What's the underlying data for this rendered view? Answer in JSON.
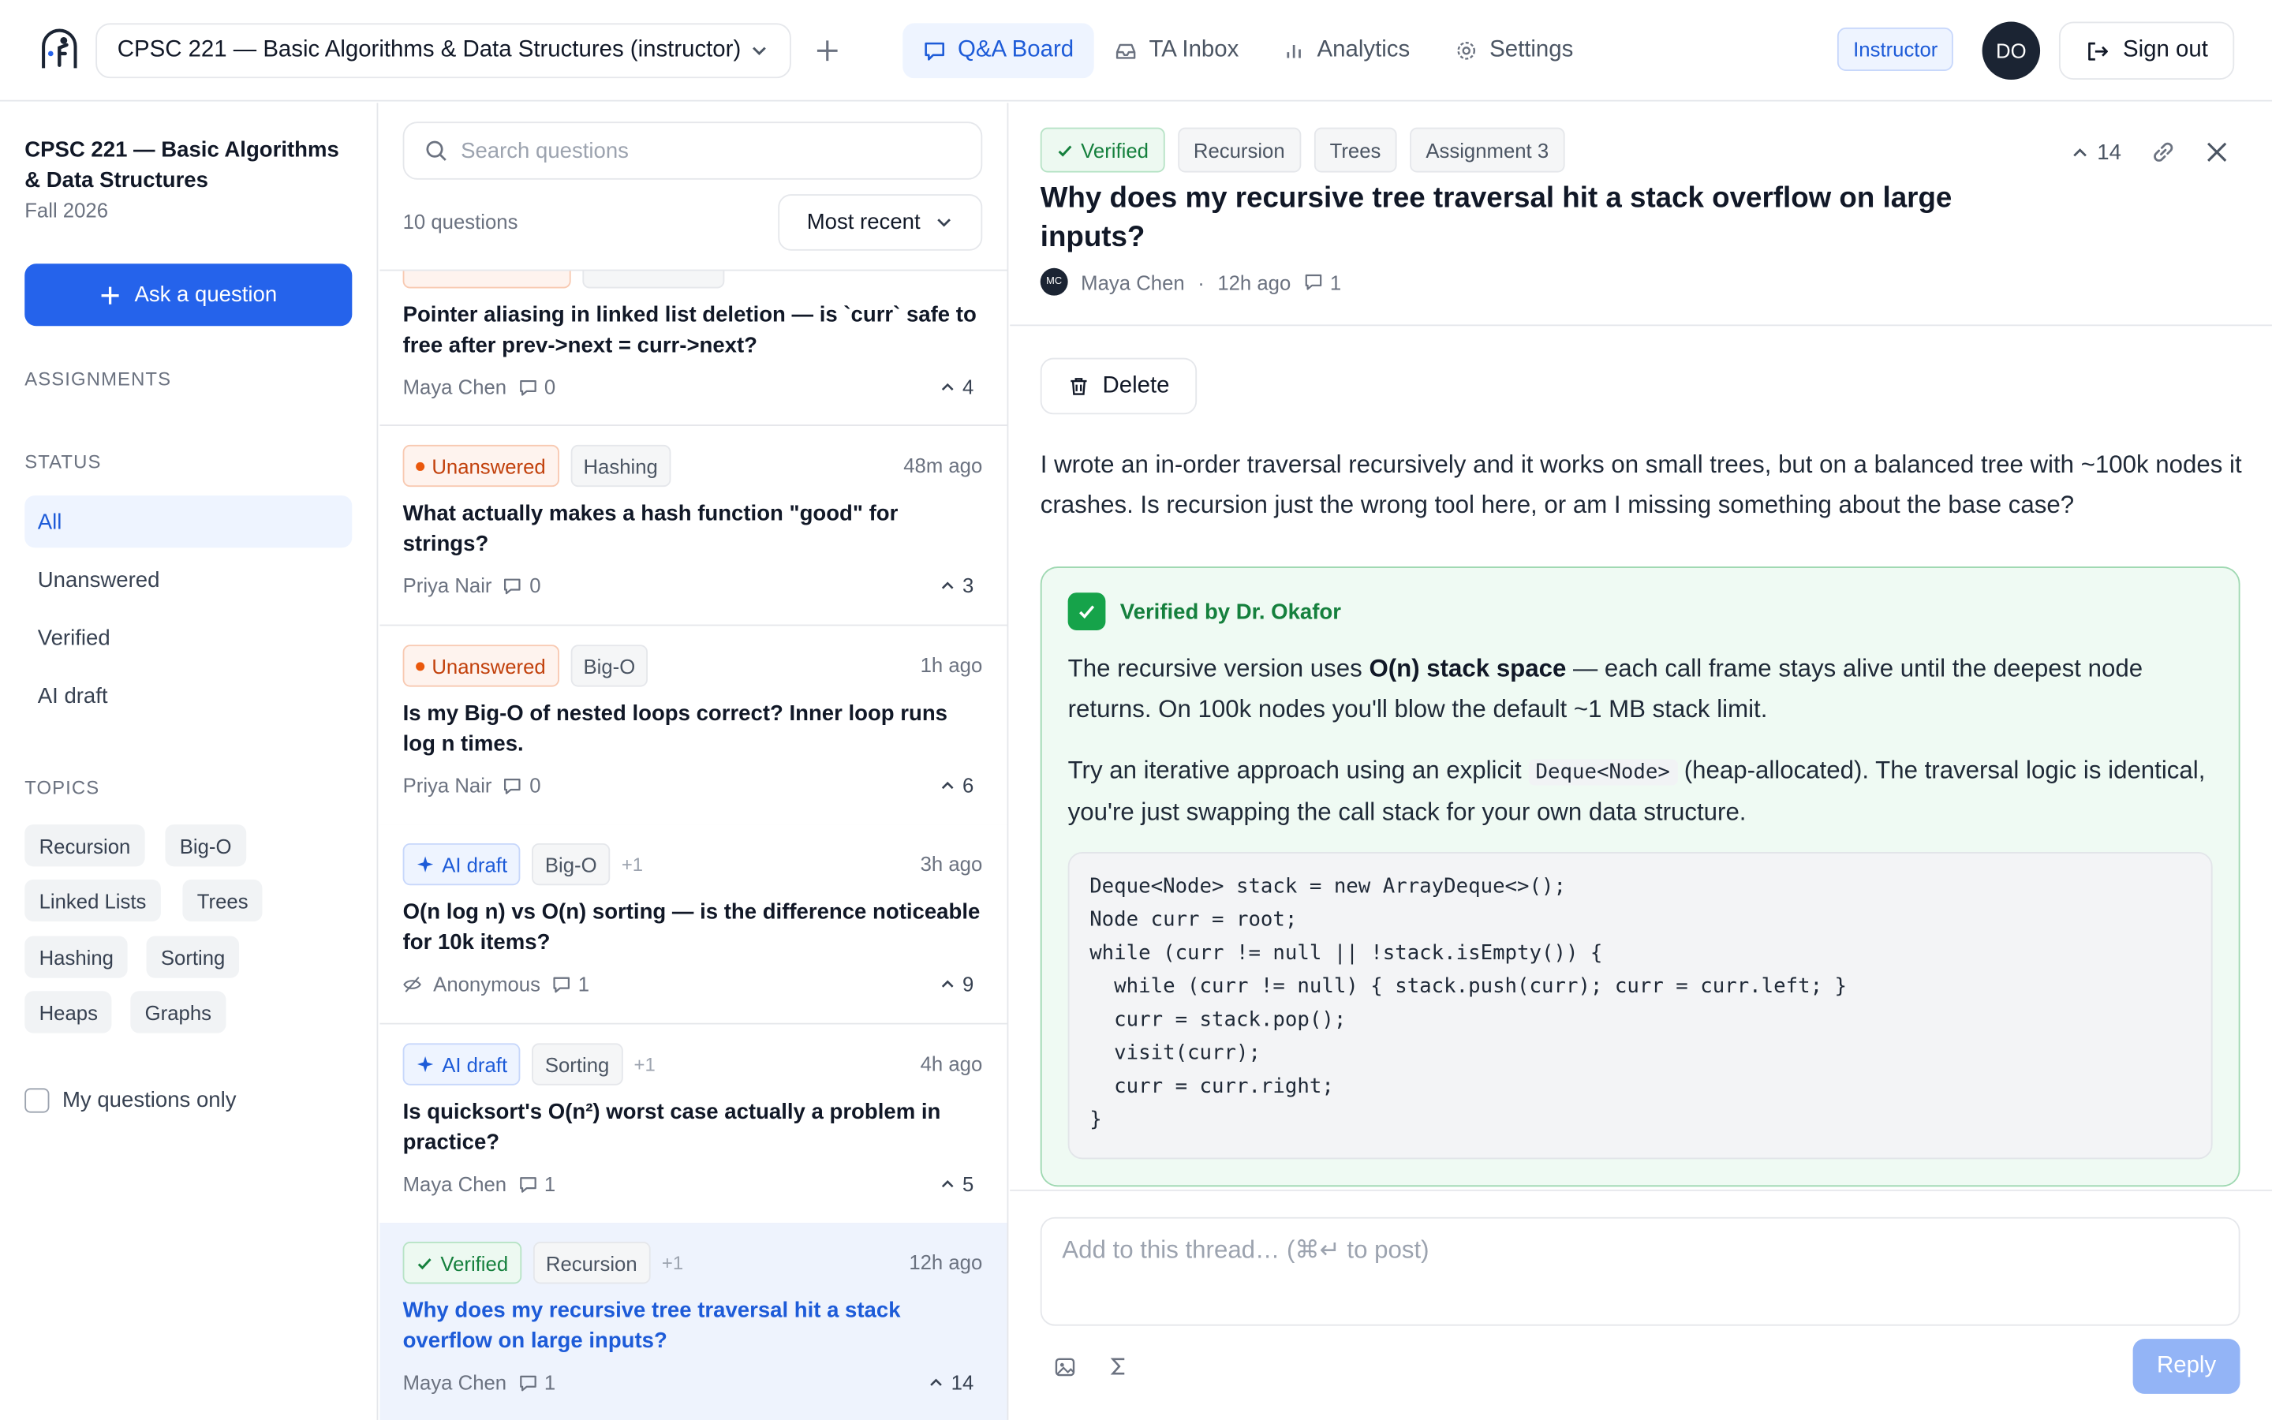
{
  "header": {
    "course_select": "CPSC 221 — Basic Algorithms & Data Structures (instructor)",
    "nav": [
      {
        "label": "Q&A Board",
        "icon": "message-square-icon"
      },
      {
        "label": "TA Inbox",
        "icon": "inbox-icon"
      },
      {
        "label": "Analytics",
        "icon": "bar-chart-icon"
      },
      {
        "label": "Settings",
        "icon": "gear-icon"
      }
    ],
    "role_badge": "Instructor",
    "avatar_initials": "DO",
    "signout_label": "Sign out"
  },
  "sidebar": {
    "course_title": "CPSC 221 — Basic Algorithms & Data Structures",
    "term": "Fall 2026",
    "ask_label": "Ask a question",
    "assignments_heading": "ASSIGNMENTS",
    "status_heading": "STATUS",
    "status_items": [
      "All",
      "Unanswered",
      "Verified",
      "AI draft"
    ],
    "topics_heading": "TOPICS",
    "topics": [
      "Recursion",
      "Big-O",
      "Linked Lists",
      "Trees",
      "Hashing",
      "Sorting",
      "Heaps",
      "Graphs"
    ],
    "my_questions_label": "My questions only"
  },
  "list": {
    "search_placeholder": "Search questions",
    "count": "10 questions",
    "sort": "Most recent",
    "questions": [
      {
        "title": "Pointer aliasing in linked list deletion — is `curr` safe to free after prev->next = curr->next?",
        "author": "Maya Chen",
        "comments": "0",
        "votes": "4"
      },
      {
        "status": "Unanswered",
        "tag": "Hashing",
        "time": "48m ago",
        "title": "What actually makes a hash function \"good\" for strings?",
        "author": "Priya Nair",
        "comments": "0",
        "votes": "3"
      },
      {
        "status": "Unanswered",
        "tag": "Big-O",
        "time": "1h ago",
        "title": "Is my Big-O of nested loops correct? Inner loop runs log n times.",
        "author": "Priya Nair",
        "comments": "0",
        "votes": "6"
      },
      {
        "status": "AI draft",
        "tag": "Big-O",
        "more": "+1",
        "time": "3h ago",
        "title": "O(n log n) vs O(n) sorting — is the difference noticeable for 10k items?",
        "author": "Anonymous",
        "comments": "1",
        "votes": "9"
      },
      {
        "status": "AI draft",
        "tag": "Sorting",
        "more": "+1",
        "time": "4h ago",
        "title": "Is quicksort's O(n²) worst case actually a problem in practice?",
        "author": "Maya Chen",
        "comments": "1",
        "votes": "5"
      },
      {
        "status": "Verified",
        "tag": "Recursion",
        "more": "+1",
        "time": "12h ago",
        "title": "Why does my recursive tree traversal hit a stack overflow on large inputs?",
        "author": "Maya Chen",
        "comments": "1",
        "votes": "14"
      }
    ]
  },
  "detail": {
    "tags": [
      "Verified",
      "Recursion",
      "Trees",
      "Assignment 3"
    ],
    "votes": "14",
    "title": "Why does my recursive tree traversal hit a stack overflow on large inputs?",
    "author_initials": "MC",
    "author": "Maya Chen",
    "time": "12h ago",
    "comments": "1",
    "delete_label": "Delete",
    "body": "I wrote an in-order traversal recursively and it works on small trees, but on a balanced tree with ~100k nodes it crashes. Is recursion just the wrong tool here, or am I missing something about the base case?",
    "answer": {
      "heading": "Verified by Dr. Okafor",
      "p1_before": "The recursive version uses ",
      "p1_bold": "O(n) stack space",
      "p1_after": " — each call frame stays alive until the deepest node returns. On 100k nodes you'll blow the default ~1 MB stack limit.",
      "p2_before": "Try an iterative approach using an explicit ",
      "p2_code": "Deque<Node>",
      "p2_after": " (heap-allocated). The traversal logic is identical, you're just swapping the call stack for your own data structure.",
      "code": [
        "Deque<Node> stack = new ArrayDeque<>();",
        "Node curr = root;",
        "while (curr != null || !stack.isEmpty()) {",
        "  while (curr != null) { stack.push(curr); curr = curr.left; }",
        "  curr = stack.pop();",
        "  visit(curr);",
        "  curr = curr.right;",
        "}"
      ]
    },
    "reply_placeholder": "Add to this thread… (⌘↵ to post)",
    "reply_label": "Reply"
  }
}
